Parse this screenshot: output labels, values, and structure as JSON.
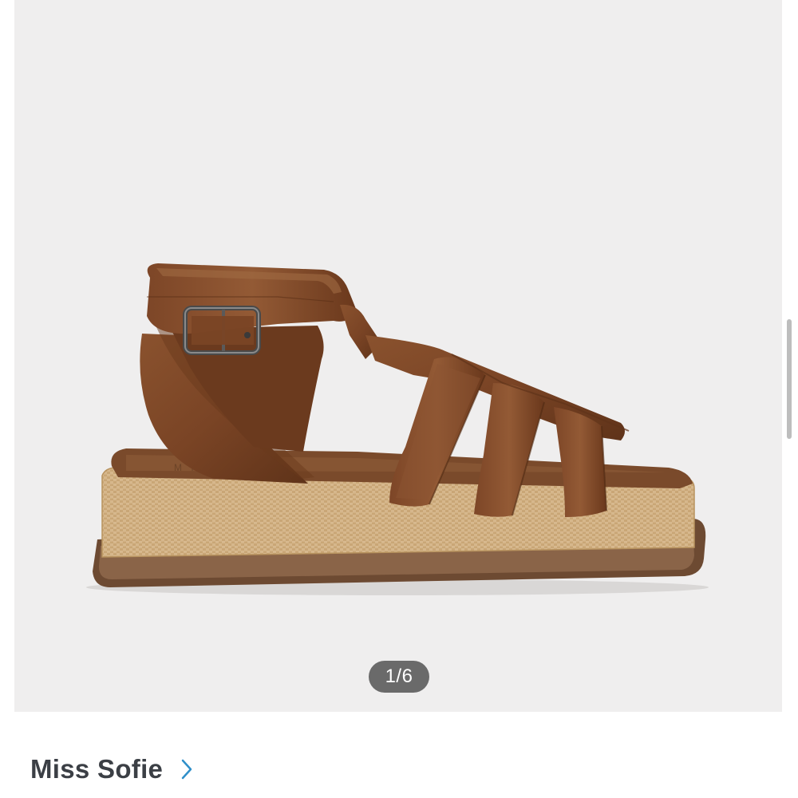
{
  "gallery": {
    "counter": "1/6",
    "image_alt": "Brown leather fisherman platform sandal with ankle strap and buckle"
  },
  "brand": {
    "name": "Miss Sofie",
    "chevron_icon": "chevron-right-icon"
  },
  "colors": {
    "gallery_bg": "#efeeee",
    "leather": "#7a4425",
    "raffia": "#d4b488",
    "brand_text": "#3b3f45",
    "chevron": "#2f8fc9",
    "counter_bg": "#6a6a6a"
  }
}
